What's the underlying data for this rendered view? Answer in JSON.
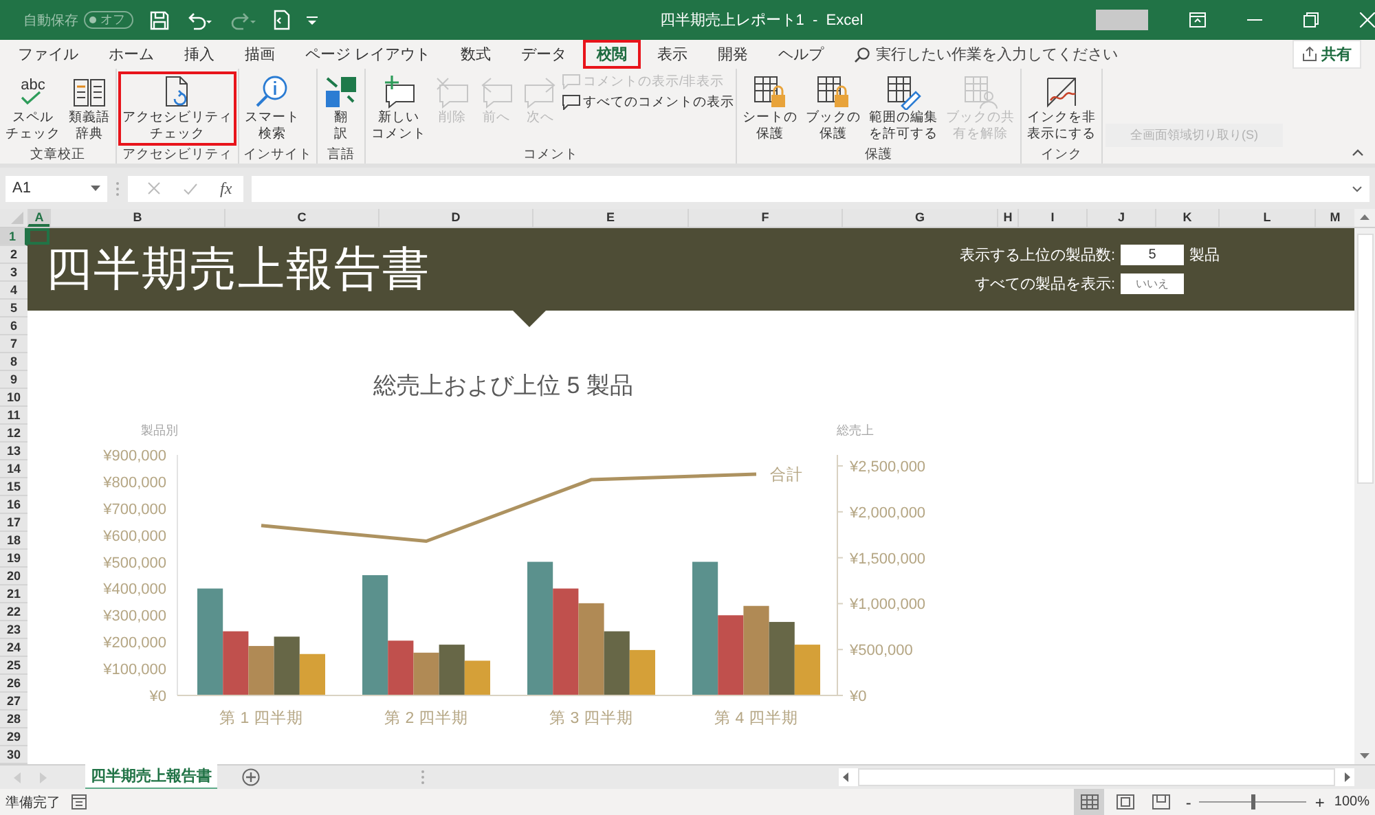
{
  "titlebar": {
    "autosave_label": "自動保存",
    "autosave_toggle": "オフ",
    "autosave_on": false,
    "title": "四半期売上レポート1  -  Excel"
  },
  "tabs": [
    {
      "label": "ファイル",
      "selected": false,
      "highlighted": false
    },
    {
      "label": "ホーム",
      "selected": false,
      "highlighted": false
    },
    {
      "label": "挿入",
      "selected": false,
      "highlighted": false
    },
    {
      "label": "描画",
      "selected": false,
      "highlighted": false
    },
    {
      "label": "ページ レイアウト",
      "selected": false,
      "highlighted": false
    },
    {
      "label": "数式",
      "selected": false,
      "highlighted": false
    },
    {
      "label": "データ",
      "selected": false,
      "highlighted": false
    },
    {
      "label": "校閲",
      "selected": true,
      "highlighted": true
    },
    {
      "label": "表示",
      "selected": false,
      "highlighted": false
    },
    {
      "label": "開発",
      "selected": false,
      "highlighted": false
    },
    {
      "label": "ヘルプ",
      "selected": false,
      "highlighted": false
    }
  ],
  "tell_me": {
    "placeholder": "実行したい作業を入力してください"
  },
  "share_button": "共有",
  "ribbon_groups": [
    {
      "label": "文章校正",
      "buttons": [
        {
          "label": [
            "スペル",
            "チェック"
          ],
          "kind": "spell",
          "icon_text": "abc",
          "disabled": false,
          "highlighted": false
        },
        {
          "label": [
            "類義語",
            "辞典"
          ],
          "kind": "book",
          "disabled": false,
          "highlighted": false
        }
      ]
    },
    {
      "label": "アクセシビリティ",
      "buttons": [
        {
          "label": [
            "アクセシビリティ",
            "チェック"
          ],
          "kind": "accessibility",
          "disabled": false,
          "highlighted": true
        }
      ]
    },
    {
      "label": "インサイト",
      "buttons": [
        {
          "label": [
            "スマート",
            "検索"
          ],
          "kind": "smart",
          "disabled": false,
          "highlighted": false
        }
      ]
    },
    {
      "label": "言語",
      "buttons": [
        {
          "label": [
            "翻",
            "訳"
          ],
          "kind": "translate",
          "disabled": false,
          "highlighted": false
        }
      ]
    },
    {
      "label": "コメント",
      "buttons": [
        {
          "label": [
            "新しい",
            "コメント"
          ],
          "kind": "comment_new",
          "disabled": false,
          "highlighted": false
        },
        {
          "label": [
            "削除"
          ],
          "kind": "comment_delete",
          "disabled": true,
          "highlighted": false
        },
        {
          "label": [
            "前へ"
          ],
          "kind": "comment_prev",
          "disabled": true,
          "highlighted": false
        },
        {
          "label": [
            "次へ"
          ],
          "kind": "comment_next",
          "disabled": true,
          "highlighted": false
        }
      ],
      "small_buttons": [
        {
          "label": "コメントの表示/非表示",
          "disabled": true
        },
        {
          "label": "すべてのコメントの表示",
          "disabled": false
        }
      ]
    },
    {
      "label": "保護",
      "buttons": [
        {
          "label": [
            "シートの",
            "保護"
          ],
          "kind": "sheet_lock",
          "disabled": false,
          "highlighted": false
        },
        {
          "label": [
            "ブックの",
            "保護"
          ],
          "kind": "book_lock",
          "disabled": false,
          "highlighted": false
        },
        {
          "label": [
            "範囲の編集",
            "を許可する"
          ],
          "kind": "range_edit",
          "disabled": false,
          "highlighted": false
        },
        {
          "label": [
            "ブックの共",
            "有を解除"
          ],
          "kind": "unshare",
          "disabled": true,
          "highlighted": false
        }
      ]
    },
    {
      "label": "インク",
      "buttons": [
        {
          "label": [
            "インクを非",
            "表示にする"
          ],
          "kind": "ink",
          "disabled": false,
          "highlighted": false
        }
      ]
    }
  ],
  "screen_clip_hint": "全画面領域切り取り(S)",
  "formula_bar": {
    "name_box": "A1",
    "function_label": "fx"
  },
  "columns": [
    {
      "label": "A",
      "selected": true
    },
    {
      "label": "B",
      "selected": false
    },
    {
      "label": "C",
      "selected": false
    },
    {
      "label": "D",
      "selected": false
    },
    {
      "label": "E",
      "selected": false
    },
    {
      "label": "F",
      "selected": false
    },
    {
      "label": "G",
      "selected": false
    },
    {
      "label": "H",
      "selected": false
    },
    {
      "label": "I",
      "selected": false
    },
    {
      "label": "J",
      "selected": false
    },
    {
      "label": "K",
      "selected": false
    },
    {
      "label": "L",
      "selected": false
    },
    {
      "label": "M",
      "selected": false
    }
  ],
  "rows": [
    {
      "label": "1",
      "selected": true
    },
    {
      "label": "2",
      "selected": false
    },
    {
      "label": "3",
      "selected": false
    },
    {
      "label": "4",
      "selected": false
    },
    {
      "label": "5",
      "selected": false
    },
    {
      "label": "6",
      "selected": false
    },
    {
      "label": "7",
      "selected": false
    },
    {
      "label": "8",
      "selected": false
    },
    {
      "label": "9",
      "selected": false
    },
    {
      "label": "10",
      "selected": false
    },
    {
      "label": "11",
      "selected": false
    },
    {
      "label": "12",
      "selected": false
    },
    {
      "label": "13",
      "selected": false
    },
    {
      "label": "14",
      "selected": false
    },
    {
      "label": "15",
      "selected": false
    },
    {
      "label": "16",
      "selected": false
    },
    {
      "label": "17",
      "selected": false
    },
    {
      "label": "18",
      "selected": false
    },
    {
      "label": "19",
      "selected": false
    },
    {
      "label": "20",
      "selected": false
    },
    {
      "label": "21",
      "selected": false
    },
    {
      "label": "22",
      "selected": false
    },
    {
      "label": "23",
      "selected": false
    },
    {
      "label": "24",
      "selected": false
    },
    {
      "label": "25",
      "selected": false
    },
    {
      "label": "26",
      "selected": false
    },
    {
      "label": "27",
      "selected": false
    },
    {
      "label": "28",
      "selected": false
    },
    {
      "label": "29",
      "selected": false
    },
    {
      "label": "30",
      "selected": false
    }
  ],
  "report": {
    "title": "四半期売上報告書",
    "top_n_label": "表示する上位の製品数:",
    "top_n_value": "5",
    "top_n_unit": "製品",
    "show_all_label": "すべての製品を表示:",
    "show_all_value": "いいえ"
  },
  "chart_data": {
    "type": "bar",
    "title": "総売上および上位  5 製品",
    "ylabel": "製品別",
    "y2label": "総売上",
    "categories": [
      "第 1 四半期",
      "第 2 四半期",
      "第 3 四半期",
      "第 4 四半期"
    ],
    "series": [
      {
        "color": "#5b918d",
        "values": [
          400000,
          450000,
          500000,
          500000
        ]
      },
      {
        "color": "#c0504d",
        "values": [
          240000,
          205000,
          400000,
          300000
        ]
      },
      {
        "color": "#b08a55",
        "values": [
          185000,
          160000,
          345000,
          335000
        ]
      },
      {
        "color": "#676747",
        "values": [
          220000,
          190000,
          240000,
          275000
        ]
      },
      {
        "color": "#d5a038",
        "values": [
          155000,
          130000,
          170000,
          190000
        ]
      },
      {
        "name": "合計",
        "type": "line",
        "axis": "y2",
        "color": "#ad9260",
        "values": [
          1850000,
          1680000,
          2350000,
          2410000
        ]
      }
    ],
    "ylim": [
      0,
      900000
    ],
    "yticks": [
      {
        "value": 0,
        "label": "¥0"
      },
      {
        "value": 100000,
        "label": "¥100,000"
      },
      {
        "value": 200000,
        "label": "¥200,000"
      },
      {
        "value": 300000,
        "label": "¥300,000"
      },
      {
        "value": 400000,
        "label": "¥400,000"
      },
      {
        "value": 500000,
        "label": "¥500,000"
      },
      {
        "value": 600000,
        "label": "¥600,000"
      },
      {
        "value": 700000,
        "label": "¥700,000"
      },
      {
        "value": 800000,
        "label": "¥800,000"
      },
      {
        "value": 900000,
        "label": "¥900,000"
      }
    ],
    "y2lim": [
      0,
      2620000
    ],
    "y2ticks": [
      {
        "value": 0,
        "label": "¥0"
      },
      {
        "value": 500000,
        "label": "¥500,000"
      },
      {
        "value": 1000000,
        "label": "¥1,000,000"
      },
      {
        "value": 1500000,
        "label": "¥1,500,000"
      },
      {
        "value": 2000000,
        "label": "¥2,000,000"
      },
      {
        "value": 2500000,
        "label": "¥2,500,000"
      }
    ]
  },
  "sheet_tabs": [
    {
      "label": "四半期売上報告書",
      "selected": true
    }
  ],
  "status_bar": {
    "text": "準備完了",
    "views": [
      {
        "kind": "normal",
        "selected": true
      },
      {
        "kind": "page_layout",
        "selected": false
      },
      {
        "kind": "page_break",
        "selected": false
      }
    ],
    "zoom_out": "-",
    "zoom_in": "+",
    "zoom_slider": {
      "level": 0.5
    },
    "zoom": "100%"
  }
}
